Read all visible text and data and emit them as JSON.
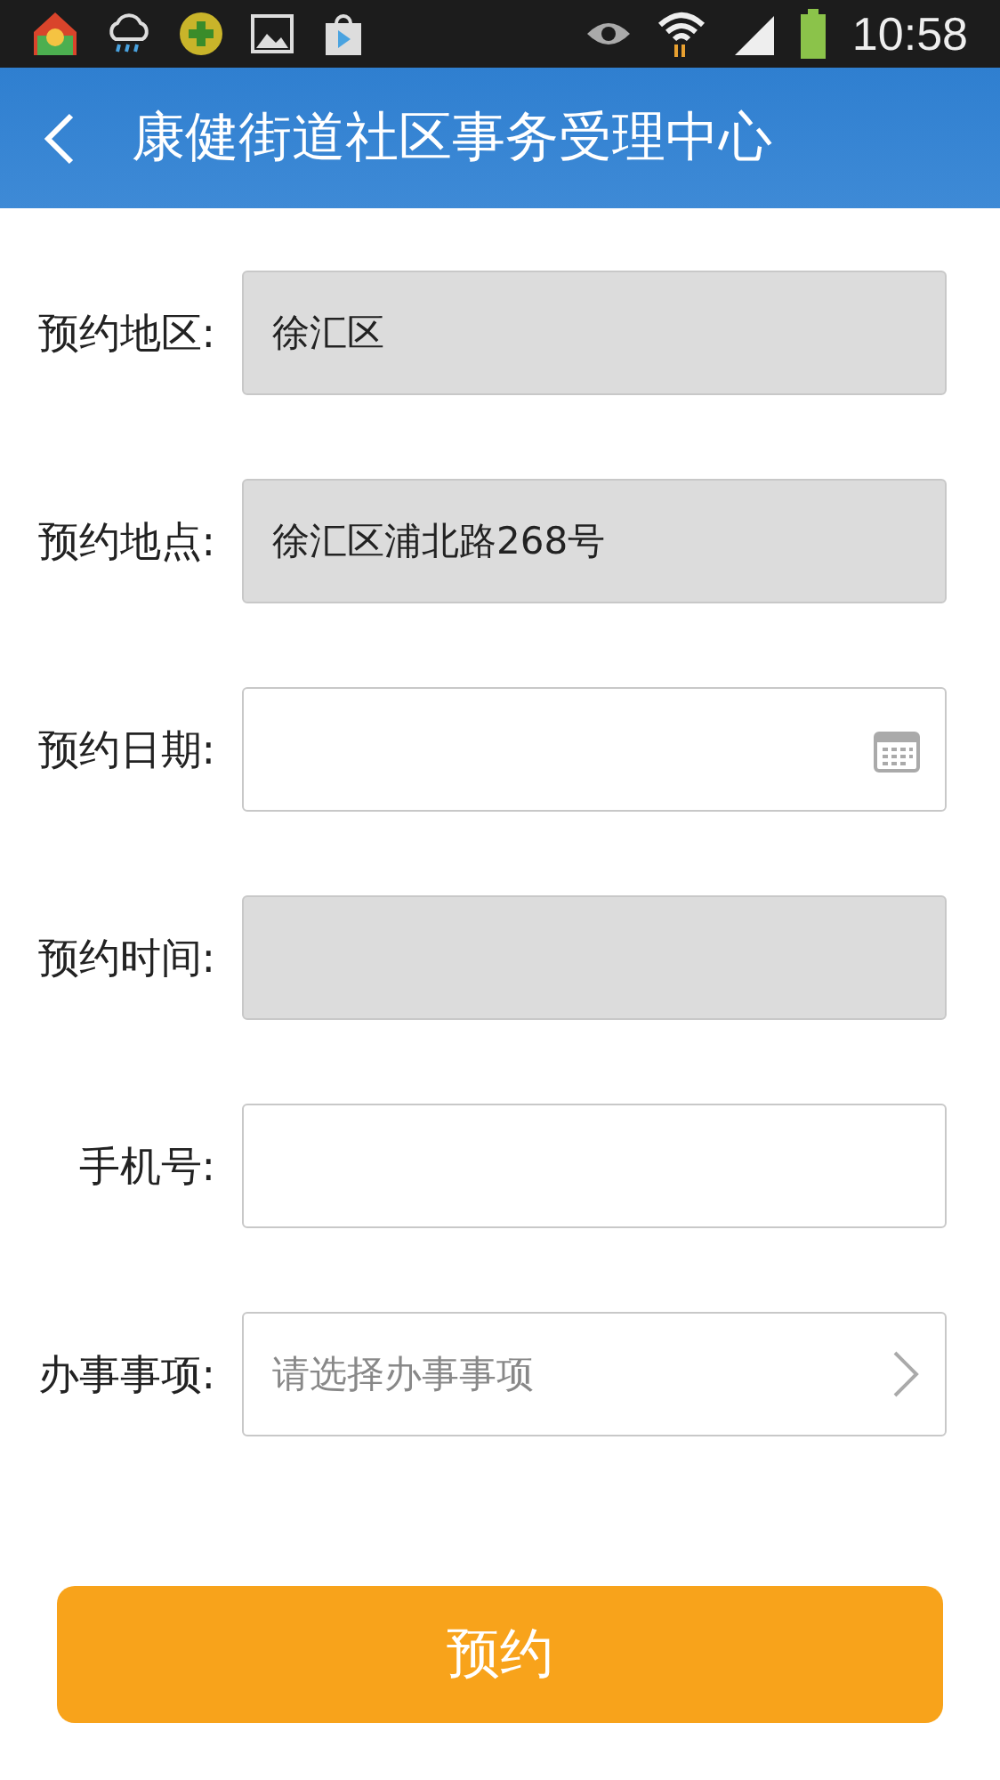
{
  "status_bar": {
    "time": "10:58"
  },
  "header": {
    "title": "康健街道社区事务受理中心"
  },
  "fields": [
    {
      "label": "预约地区:",
      "kind": "text",
      "disabled": true,
      "value": "徐汇区"
    },
    {
      "label": "预约地点:",
      "kind": "text",
      "disabled": true,
      "value": "徐汇区浦北路268号"
    },
    {
      "label": "预约日期:",
      "kind": "date",
      "disabled": false
    },
    {
      "label": "预约时间:",
      "kind": "text",
      "disabled": true
    },
    {
      "label": "手机号:",
      "kind": "text",
      "disabled": false
    },
    {
      "label": "办事事项:",
      "kind": "select",
      "disabled": false,
      "placeholder": "请选择办事事项"
    }
  ],
  "submit_button": {
    "label": "预约"
  }
}
